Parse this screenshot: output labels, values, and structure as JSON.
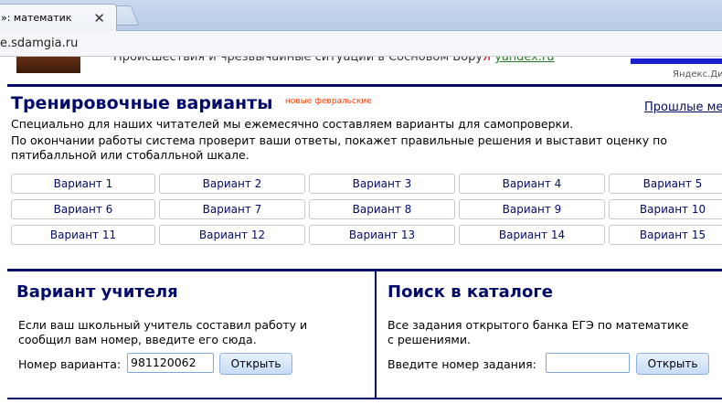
{
  "browser": {
    "tab_title": "»: математик",
    "tab_close": "✕",
    "url": "e.sdamgia.ru"
  },
  "banner": {
    "text": "Происшествия и чрезвычайные ситуации в Сосновом Бору",
    "yandex_letter": "Я",
    "yandex_link": "yandex.ru",
    "direct_label": "Яндекс.Ди"
  },
  "training": {
    "title": "Тренировочные варианты",
    "badge": "новые февральские",
    "past_link": "Прошлые ме",
    "description": [
      "Специально для наших читателей мы ежемесячно составляем варианты для самопроверки.",
      "По окончании работы система проверит ваши ответы, покажет правильные решения и выставит оценку по",
      "пятибалльной или стобалльной шкале."
    ],
    "variants": [
      [
        "Вариант 1",
        "Вариант 2",
        "Вариант 3",
        "Вариант 4",
        "Вариант 5"
      ],
      [
        "Вариант 6",
        "Вариант 7",
        "Вариант 8",
        "Вариант 9",
        "Вариант 10"
      ],
      [
        "Вариант 11",
        "Вариант 12",
        "Вариант 13",
        "Вариант 14",
        "Вариант 15"
      ]
    ]
  },
  "teacher": {
    "title": "Вариант учителя",
    "text": [
      "Если ваш школьный учитель составил работу и",
      "сообщил вам номер, введите его сюда."
    ],
    "label": "Номер варианта:",
    "value": "981120062",
    "button": "Открыть"
  },
  "catalog": {
    "title": "Поиск в каталоге",
    "text": [
      "Все задания открытого банка ЕГЭ по математике",
      "с решениями."
    ],
    "label": "Введите номер задания:",
    "value": "",
    "button": "Открыть"
  }
}
